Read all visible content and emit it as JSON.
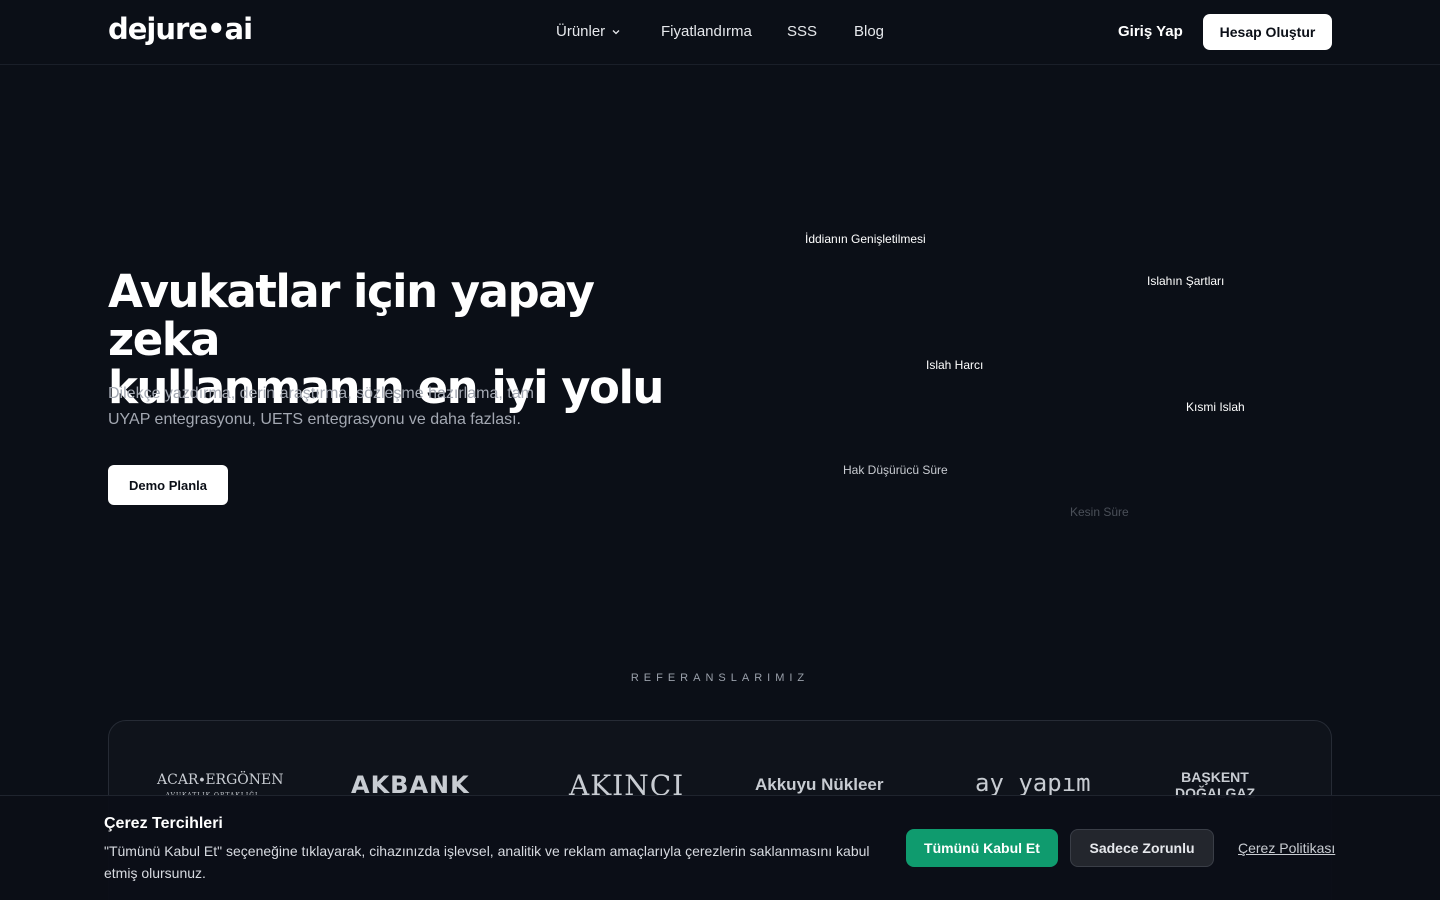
{
  "header": {
    "logo": "dejure•ai",
    "nav": [
      {
        "label": "Ürünler",
        "icon": "chevron-down-icon"
      },
      {
        "label": "Fiyatlandırma"
      },
      {
        "label": "SSS"
      },
      {
        "label": "Blog"
      }
    ],
    "login_label": "Giriş Yap",
    "signup_label": "Hesap Oluştur"
  },
  "hero": {
    "title_line1": "Avukatlar için yapay zeka",
    "title_line2": "kullanmanın en iyi yolu",
    "subtitle": "Dilekçe yazdırma, derin araştırma, sözleşme hazırlama, tam UYAP entegrasyonu, UETS entegrasyonu ve daha fazlası.",
    "cta_label": "Demo Planla"
  },
  "floating_tags": [
    {
      "label": "İddianın Genişletilmesi",
      "color": "#ffffff"
    },
    {
      "label": "Islahın Şartları",
      "color": "#ffffff"
    },
    {
      "label": "Islah Harcı",
      "color": "#ffffff"
    },
    {
      "label": "Kısmi Islah",
      "color": "#ffffff"
    },
    {
      "label": "Hak Düşürücü Süre",
      "color": "#c9ccd2"
    },
    {
      "label": "Kesin Süre",
      "color": "#4a4f58"
    }
  ],
  "references": {
    "label": "REFERANSLARIMIZ",
    "logos": [
      {
        "main": "ACAR∙ERGÖNEN",
        "sub": "AVUKATLIK ORTAKLIĞI"
      },
      {
        "main": "AKBANK"
      },
      {
        "main": "AKINCI"
      },
      {
        "main": "Akkuyu Nükleer"
      },
      {
        "main": "ay yapım"
      },
      {
        "main": "BAŞKENT",
        "sub": "DOĞALGAZ"
      }
    ]
  },
  "cookie": {
    "title": "Çerez Tercihleri",
    "text": "\"Tümünü Kabul Et\" seçeneğine tıklayarak, cihazınızda işlevsel, analitik ve reklam amaçlarıyla çerezlerin saklanmasını kabul etmiş olursunuz.",
    "accept_label": "Tümünü Kabul Et",
    "necessary_label": "Sadece Zorunlu",
    "policy_label": "Çerez Politikası",
    "accept_color": "#0f9b6e"
  }
}
